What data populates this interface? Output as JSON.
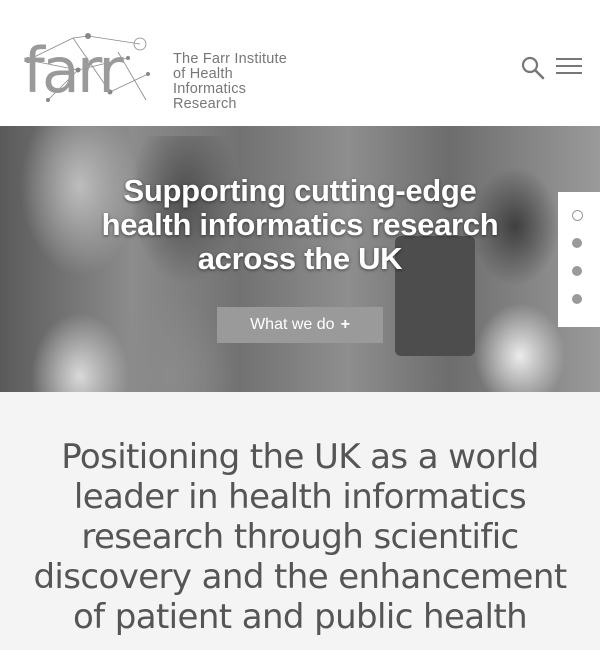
{
  "header": {
    "logo_word": "farr",
    "logo_lines": [
      "The Farr Institute",
      "of Health Informatics",
      "Research"
    ],
    "search_icon": "search-icon",
    "menu_icon": "hamburger-menu-icon"
  },
  "hero": {
    "title_lines": [
      "Supporting cutting-edge",
      "health informatics research",
      "across the UK"
    ],
    "cta_label": "What we do",
    "cta_icon": "+",
    "slider_dots": 4,
    "active_dot": 0
  },
  "mission": {
    "text": "Positioning the UK as a world leader in health informatics research through scientific discovery and the enhancement of patient and public health"
  },
  "colors": {
    "header_bg": "#ffffff",
    "cta_bg": "#9a9a9a",
    "mission_bg": "#f4f4f4",
    "text_gray": "#555555"
  }
}
